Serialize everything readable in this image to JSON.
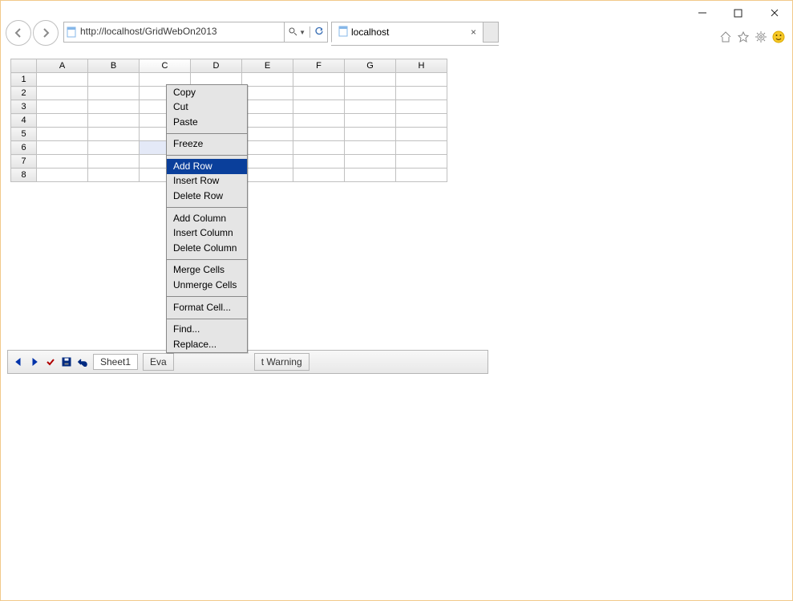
{
  "browser": {
    "url": "http://localhost/GridWebOn2013",
    "tab_title": "localhost"
  },
  "grid": {
    "columns": [
      "A",
      "B",
      "C",
      "D",
      "E",
      "F",
      "G",
      "H"
    ],
    "rows": [
      "1",
      "2",
      "3",
      "4",
      "5",
      "6",
      "7",
      "8"
    ],
    "active_column": "C",
    "selected_cell": "C6"
  },
  "context_menu": {
    "highlighted": "Add Row",
    "groups": [
      [
        "Copy",
        "Cut",
        "Paste"
      ],
      [
        "Freeze"
      ],
      [
        "Add Row",
        "Insert Row",
        "Delete Row"
      ],
      [
        "Add Column",
        "Insert Column",
        "Delete Column"
      ],
      [
        "Merge Cells",
        "Unmerge Cells"
      ],
      [
        "Format Cell..."
      ],
      [
        "Find...",
        "Replace..."
      ]
    ]
  },
  "sheet_bar": {
    "sheet_name": "Sheet1",
    "buttons": {
      "eval_prefix": "Eva",
      "warning_suffix": "t Warning"
    }
  }
}
